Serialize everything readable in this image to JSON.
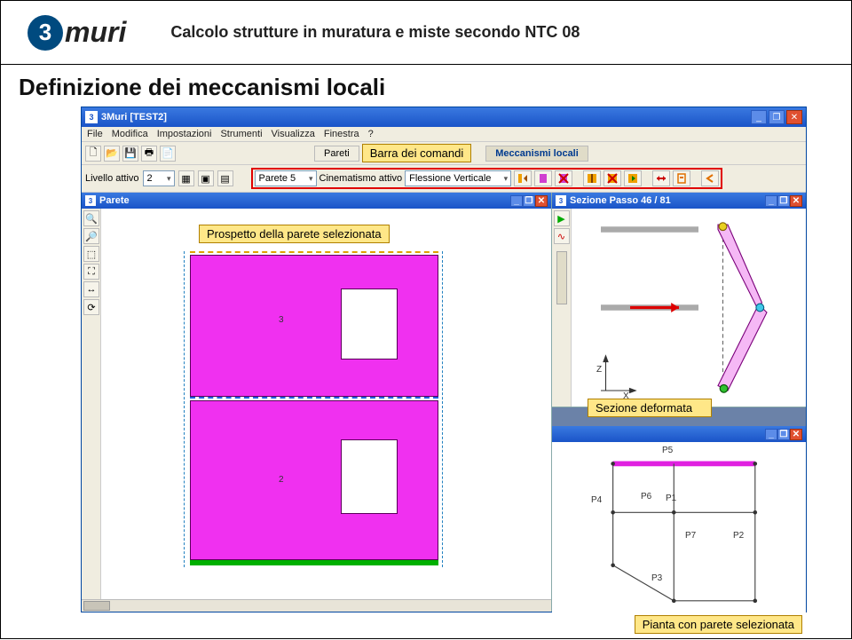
{
  "header": {
    "logo_num": "3",
    "logo_text": "muri",
    "tagline": "Calcolo strutture in muratura e miste secondo NTC 08"
  },
  "page": {
    "subtitle": "Definizione dei meccanismi locali"
  },
  "app": {
    "title": "3Muri  [TEST2]",
    "menu": [
      "File",
      "Modifica",
      "Impostazioni",
      "Strumenti",
      "Visualizza",
      "Finestra",
      "?"
    ],
    "tabs": {
      "pareti": "Pareti",
      "mecc": "Meccanismi locali"
    },
    "callouts": {
      "comandi": "Barra dei comandi",
      "prospetto": "Prospetto della parete selezionata",
      "sezione": "Sezione deformata",
      "pianta": "Pianta con parete selezionata"
    },
    "toolbar2": {
      "livello_lbl": "Livello attivo",
      "livello_val": "2",
      "parete_val": "Parete 5",
      "cin_lbl": "Cinematismo attivo",
      "cin_val": "Flessione Verticale"
    },
    "leftpanel": {
      "title": "Parete",
      "floor_labels": [
        "3",
        "2"
      ]
    },
    "section": {
      "title": "Sezione Passo 46 / 81",
      "ax_z": "Z",
      "ax_x": "X"
    },
    "plan": {
      "labels": [
        "P5",
        "P4",
        "P6",
        "P1",
        "P7",
        "P2",
        "P3"
      ]
    }
  }
}
